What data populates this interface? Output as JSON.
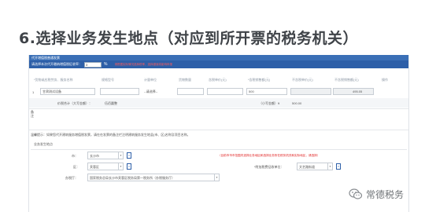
{
  "heading": "6.选择业务发生地点（对应到所开票的税务机关）",
  "form": {
    "top_title": "代开增值税普通发票",
    "collect_rate_label": "请选择本次代开缴纳增值税征收率：",
    "collect_rate_value": "3",
    "percent": "%",
    "collect_rate_warning": "请根据实际情况选择税率，选择错误将影响申报",
    "columns": [
      "*货物或应税劳务、服务名称",
      "规格型号",
      "计量单位",
      "货物数量",
      "含税单价(元)",
      "*含税销售额(元)",
      "不含税单价(元)",
      "不含税销售额(元)",
      "操作"
    ],
    "row": {
      "index": "1",
      "name": "甘肃测试设备",
      "unit": "--请选择--",
      "amount": "500",
      "excl_amount": "495.05"
    },
    "total": {
      "upper_label": "价税合计（大写金额）：",
      "upper_value": "伍佰圆整",
      "lower_label": "（小写金额）¥",
      "lower_value": "500.00"
    },
    "remark_label": "备注",
    "tip": "温馨提示：如果您代开建筑服务增值税发票，请在在发票的备注栏注明建筑服务发生地县(市、区)名称及项目名称。",
    "biz_section": {
      "title": "业务发生地点",
      "city_label": "市：",
      "city_value": "长沙市",
      "city_warning": "（目前市市市范围内选择业务地区和选择业务所在税务机关和实际地区，请选择）",
      "district_label": "区：",
      "district_value": "芙蓉区",
      "fee_label": "*附加税费征收单位：",
      "fee_value": "文艺路街道",
      "office_label": "办税厅：",
      "office_value": "国家税务总局长沙市芙蓉区税务局第一税务所（办税服务厅）"
    }
  },
  "watermark": {
    "text": "常德税务"
  }
}
